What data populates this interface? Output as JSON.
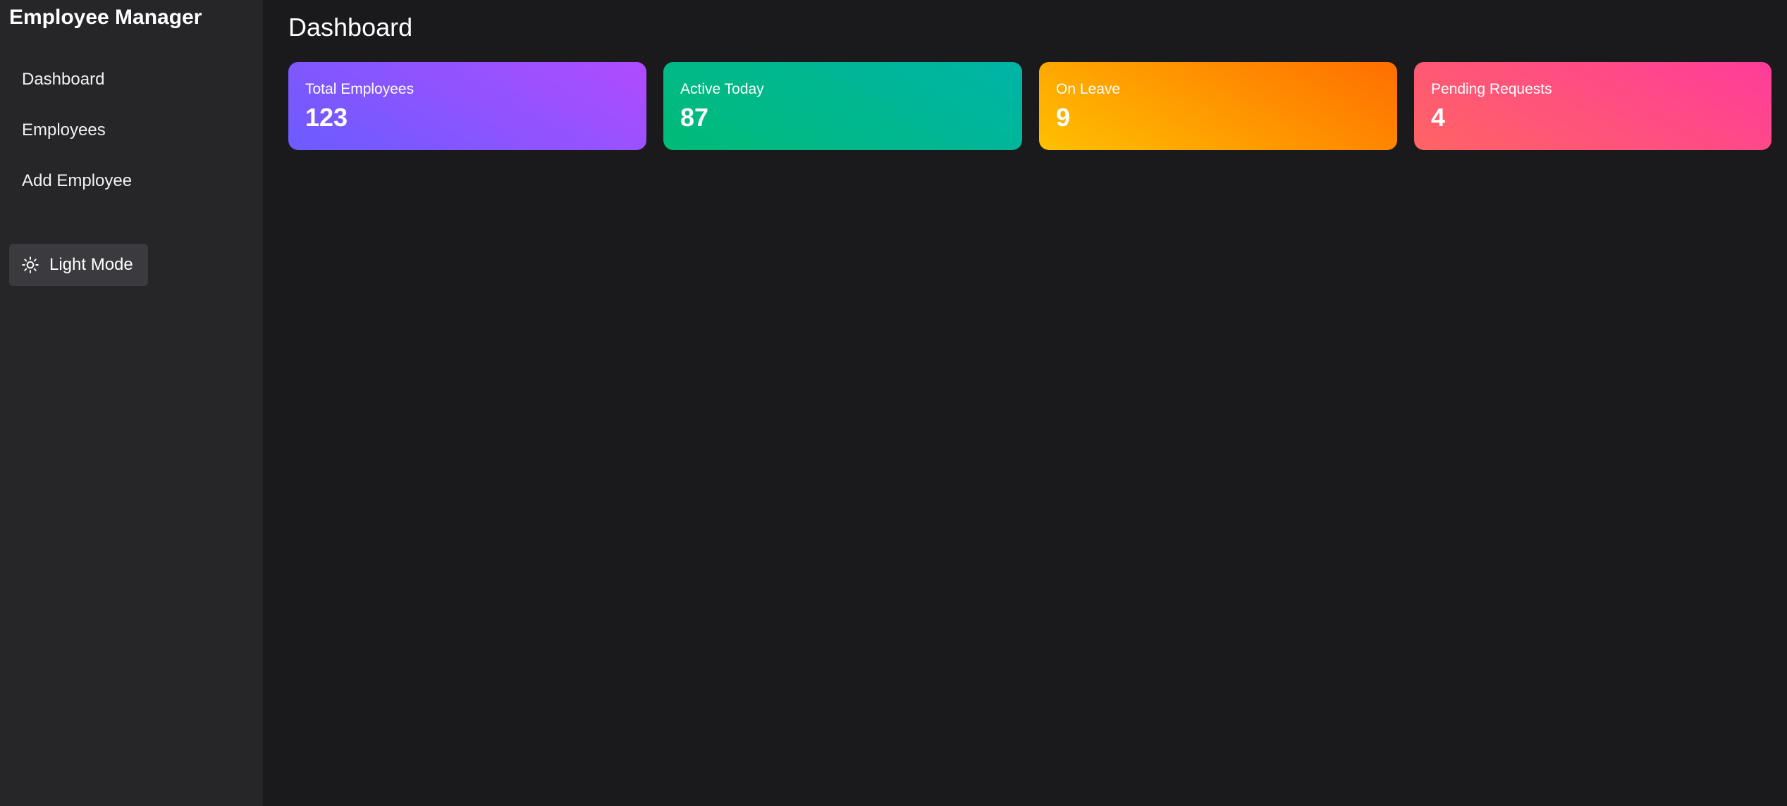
{
  "sidebar": {
    "app_title": "Employee Manager",
    "nav": [
      {
        "label": "Dashboard"
      },
      {
        "label": "Employees"
      },
      {
        "label": "Add Employee"
      }
    ],
    "theme_toggle": {
      "label": "Light Mode",
      "icon": "sun-icon"
    }
  },
  "main": {
    "title": "Dashboard",
    "stats": [
      {
        "label": "Total Employees",
        "value": "123",
        "gradient": [
          "#6b5cff",
          "#b04cff"
        ]
      },
      {
        "label": "Active Today",
        "value": "87",
        "gradient": [
          "#00bb77",
          "#00b4a8"
        ]
      },
      {
        "label": "On Leave",
        "value": "9",
        "gradient": [
          "#ffc000",
          "#ff6e00"
        ]
      },
      {
        "label": "Pending Requests",
        "value": "4",
        "gradient": [
          "#ff6464",
          "#ff3c9a"
        ]
      }
    ]
  },
  "colors": {
    "background": "#1a1a1c",
    "sidebar": "#262628",
    "toggle": "#3b3b3f"
  }
}
